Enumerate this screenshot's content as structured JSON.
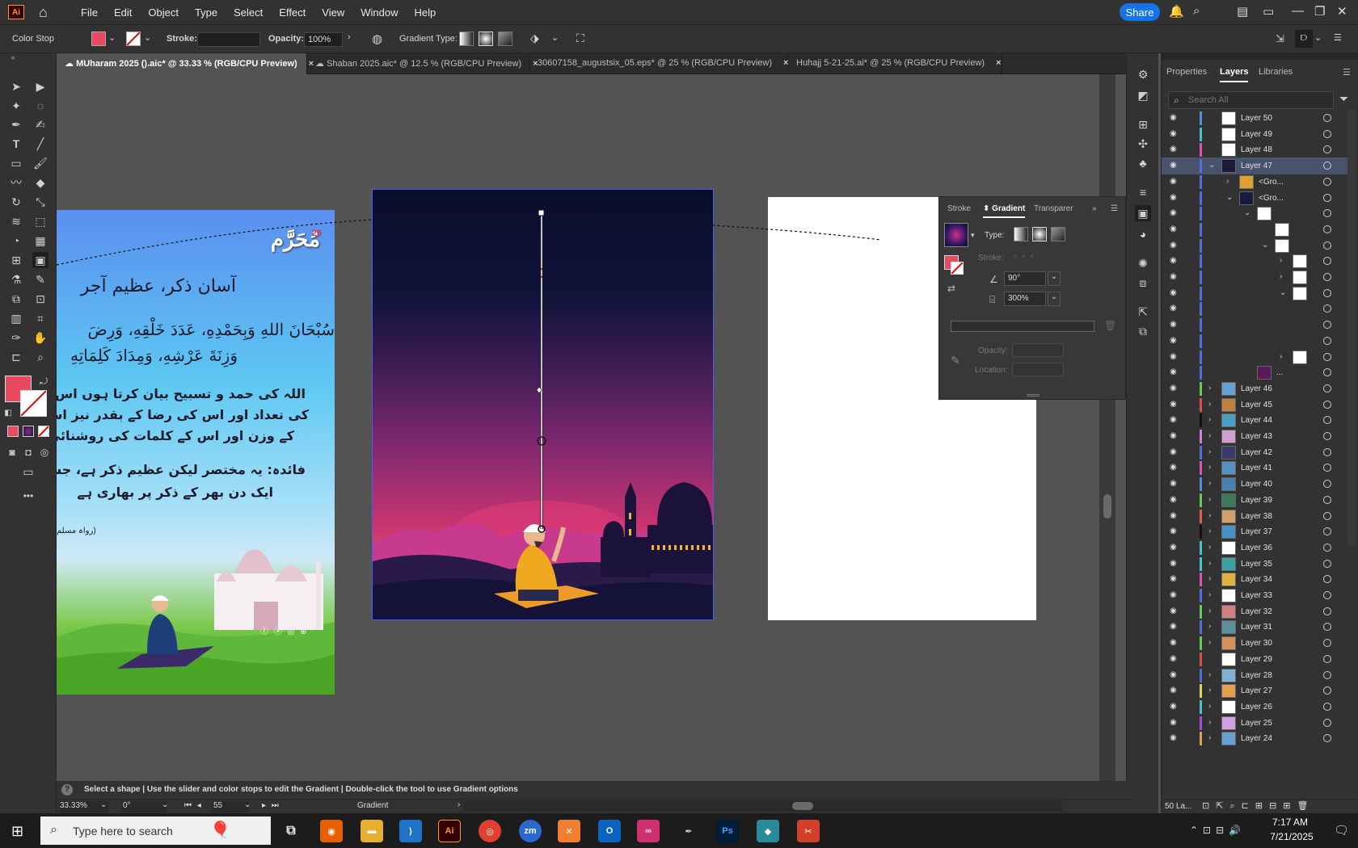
{
  "menubar": {
    "logo": "Ai",
    "items": [
      "File",
      "Edit",
      "Object",
      "Type",
      "Select",
      "Effect",
      "View",
      "Window",
      "Help"
    ],
    "share_label": "Share"
  },
  "controlbar": {
    "selection_label": "Color Stop",
    "stroke_label": "Stroke:",
    "opacity_label": "Opacity:",
    "opacity_value": "100%",
    "gradient_type_label": "Gradient Type:"
  },
  "tabs": [
    {
      "label": "MUharam 2025 ().aic* @ 33.33 % (RGB/CPU Preview)",
      "close": "×"
    },
    {
      "label": "Shaban 2025.aic* @ 12.5 % (RGB/CPU Preview)",
      "close": "×"
    },
    {
      "label": "30607158_augustsix_05.eps* @ 25 % (RGB/CPU Preview)",
      "close": "×"
    },
    {
      "label": "Huhajj 5-21-25.ai* @ 25 % (RGB/CPU Preview)",
      "close": "×"
    }
  ],
  "artboard_left": {
    "title": "مُحَرَّم",
    "badge": "25",
    "heading": "آسان ذکر، عظیم آجر",
    "arabic_line1": "سُبْحَانَ اللهِ وَبِحَمْدِهِ، عَدَدَ خَلْقِهِ، وَرِضَ",
    "arabic_line2": "وَزِنَةَ عَرْشِهِ، وَمِدَادَ كَلِمَاتِهِ",
    "urdu_line1": "اللہ کی حمد و تسبیح بیان کرتا ہوں اس",
    "urdu_line2": "کی تعداد اور اس کی رضا کے بقدر نیز اس",
    "urdu_line3": "کے وزن اور اس کے کلمات کی روشنائی",
    "benefit_line1": "فائدہ: یہ مختصر لیکن عظیم ذکر ہے، جس",
    "benefit_line2": "ایک دن بھر کے ذکر پر بھاری ہے",
    "reference": "(رواہ مسلم"
  },
  "gradient_panel": {
    "tabs": [
      "Stroke",
      "Gradient",
      "Transparer"
    ],
    "type_label": "Type:",
    "stroke_label": "Stroke:",
    "angle_value": "90°",
    "aspect_value": "300%",
    "opacity_label": "Opacity:",
    "location_label": "Location:"
  },
  "panel_tabs": [
    "Properties",
    "Layers",
    "Libraries"
  ],
  "layers_search_placeholder": "Search All",
  "layers": [
    {
      "name": "Layer 50",
      "color": "#4f8fe0",
      "indent": 0,
      "chev": "",
      "thumb": "#ffffff"
    },
    {
      "name": "Layer 49",
      "color": "#3fc8d0",
      "indent": 0,
      "chev": "",
      "thumb": "#ffffff"
    },
    {
      "name": "Layer 48",
      "color": "#e04fbf",
      "indent": 0,
      "chev": "",
      "thumb": "#ffffff"
    },
    {
      "name": "Layer 47",
      "color": "#4f6fe0",
      "indent": 0,
      "chev": "⌄",
      "thumb": "#1a1a3a",
      "selected": true
    },
    {
      "name": "<Gro...",
      "color": "#4f6fe0",
      "indent": 1,
      "chev": "›",
      "thumb": "#e0a030"
    },
    {
      "name": "<Gro...",
      "color": "#4f6fe0",
      "indent": 1,
      "chev": "⌄",
      "thumb": "#1a1a3a"
    },
    {
      "name": "",
      "color": "#4f6fe0",
      "indent": 2,
      "chev": "⌄",
      "thumb": "#ffffff"
    },
    {
      "name": "",
      "color": "#4f6fe0",
      "indent": 3,
      "chev": "",
      "thumb": "#ffffff"
    },
    {
      "name": "",
      "color": "#4f6fe0",
      "indent": 3,
      "chev": "⌄",
      "thumb": "#ffffff"
    },
    {
      "name": "",
      "color": "#4f6fe0",
      "indent": 4,
      "chev": "›",
      "thumb": "#ffffff"
    },
    {
      "name": "",
      "color": "#4f6fe0",
      "indent": 4,
      "chev": "›",
      "thumb": "#ffffff"
    },
    {
      "name": "",
      "color": "#4f6fe0",
      "indent": 4,
      "chev": "⌄",
      "thumb": "#ffffff"
    },
    {
      "name": "",
      "color": "#4f6fe0",
      "indent": 4,
      "chev": "",
      "thumb": ""
    },
    {
      "name": "",
      "color": "#4f6fe0",
      "indent": 4,
      "chev": "",
      "thumb": ""
    },
    {
      "name": "",
      "color": "#4f6fe0",
      "indent": 4,
      "chev": "",
      "thumb": ""
    },
    {
      "name": "",
      "color": "#4f6fe0",
      "indent": 4,
      "chev": "›",
      "thumb": "#ffffff"
    },
    {
      "name": "...",
      "color": "#4f6fe0",
      "indent": 2,
      "chev": "",
      "thumb": "#5a1a5a"
    },
    {
      "name": "Layer 46",
      "color": "#5fd04f",
      "indent": 0,
      "chev": "›",
      "thumb": "#6aa0d0"
    },
    {
      "name": "Layer 45",
      "color": "#e04f4f",
      "indent": 0,
      "chev": "›",
      "thumb": "#c08040"
    },
    {
      "name": "Layer 44",
      "color": "#111111",
      "indent": 0,
      "chev": "›",
      "thumb": "#4aa0c0"
    },
    {
      "name": "Layer 43",
      "color": "#d080e0",
      "indent": 0,
      "chev": "›",
      "thumb": "#d0a0d0"
    },
    {
      "name": "Layer 42",
      "color": "#4f6fe0",
      "indent": 0,
      "chev": "›",
      "thumb": "#3a3a6a"
    },
    {
      "name": "Layer 41",
      "color": "#e04fbf",
      "indent": 0,
      "chev": "›",
      "thumb": "#5a90c0"
    },
    {
      "name": "Layer 40",
      "color": "#4f8fe0",
      "indent": 0,
      "chev": "›",
      "thumb": "#4a80b0"
    },
    {
      "name": "Layer 39",
      "color": "#5fd04f",
      "indent": 0,
      "chev": "›",
      "thumb": "#3a7a5a"
    },
    {
      "name": "Layer 38",
      "color": "#e05f4f",
      "indent": 0,
      "chev": "›",
      "thumb": "#d0a070"
    },
    {
      "name": "Layer 37",
      "color": "#111111",
      "indent": 0,
      "chev": "›",
      "thumb": "#4a90c0"
    },
    {
      "name": "Layer 36",
      "color": "#3fc8d0",
      "indent": 0,
      "chev": "›",
      "thumb": "#ffffff"
    },
    {
      "name": "Layer 35",
      "color": "#3fc8d0",
      "indent": 0,
      "chev": "›",
      "thumb": "#3aa0a0"
    },
    {
      "name": "Layer 34",
      "color": "#e04fbf",
      "indent": 0,
      "chev": "›",
      "thumb": "#e0b040"
    },
    {
      "name": "Layer 33",
      "color": "#4f6fe0",
      "indent": 0,
      "chev": "›",
      "thumb": "#ffffff"
    },
    {
      "name": "Layer 32",
      "color": "#5fd04f",
      "indent": 0,
      "chev": "›",
      "thumb": "#d08080"
    },
    {
      "name": "Layer 31",
      "color": "#4f6fe0",
      "indent": 0,
      "chev": "›",
      "thumb": "#5a90a0"
    },
    {
      "name": "Layer 30",
      "color": "#5fd04f",
      "indent": 0,
      "chev": "›",
      "thumb": "#d09060"
    },
    {
      "name": "Layer 29",
      "color": "#e04f4f",
      "indent": 0,
      "chev": "",
      "thumb": "#ffffff"
    },
    {
      "name": "Layer 28",
      "color": "#4f6fe0",
      "indent": 0,
      "chev": "›",
      "thumb": "#80b0d0"
    },
    {
      "name": "Layer 27",
      "color": "#e0d04f",
      "indent": 0,
      "chev": "›",
      "thumb": "#e0a050"
    },
    {
      "name": "Layer 26",
      "color": "#3fc8d0",
      "indent": 0,
      "chev": "›",
      "thumb": "#ffffff"
    },
    {
      "name": "Layer 25",
      "color": "#9f4fe0",
      "indent": 0,
      "chev": "›",
      "thumb": "#d0a0e0"
    },
    {
      "name": "Layer 24",
      "color": "#e0a04f",
      "indent": 0,
      "chev": "›",
      "thumb": "#6aa0d0"
    }
  ],
  "layers_footer": "50 La...",
  "status": {
    "text": "Select a shape  |  Use the slider and color stops to edit the Gradient  |  Double-click the tool to use Gradient options",
    "zoom": "33.33%",
    "rotation": "0°",
    "artboard": "55",
    "tool": "Gradient"
  },
  "taskbar": {
    "search_placeholder": "Type here to search",
    "time": "7:17 AM",
    "date": "7/21/2025"
  },
  "colors": {
    "accent": "#1473e6",
    "fill_swatch": "#e84a5f"
  }
}
